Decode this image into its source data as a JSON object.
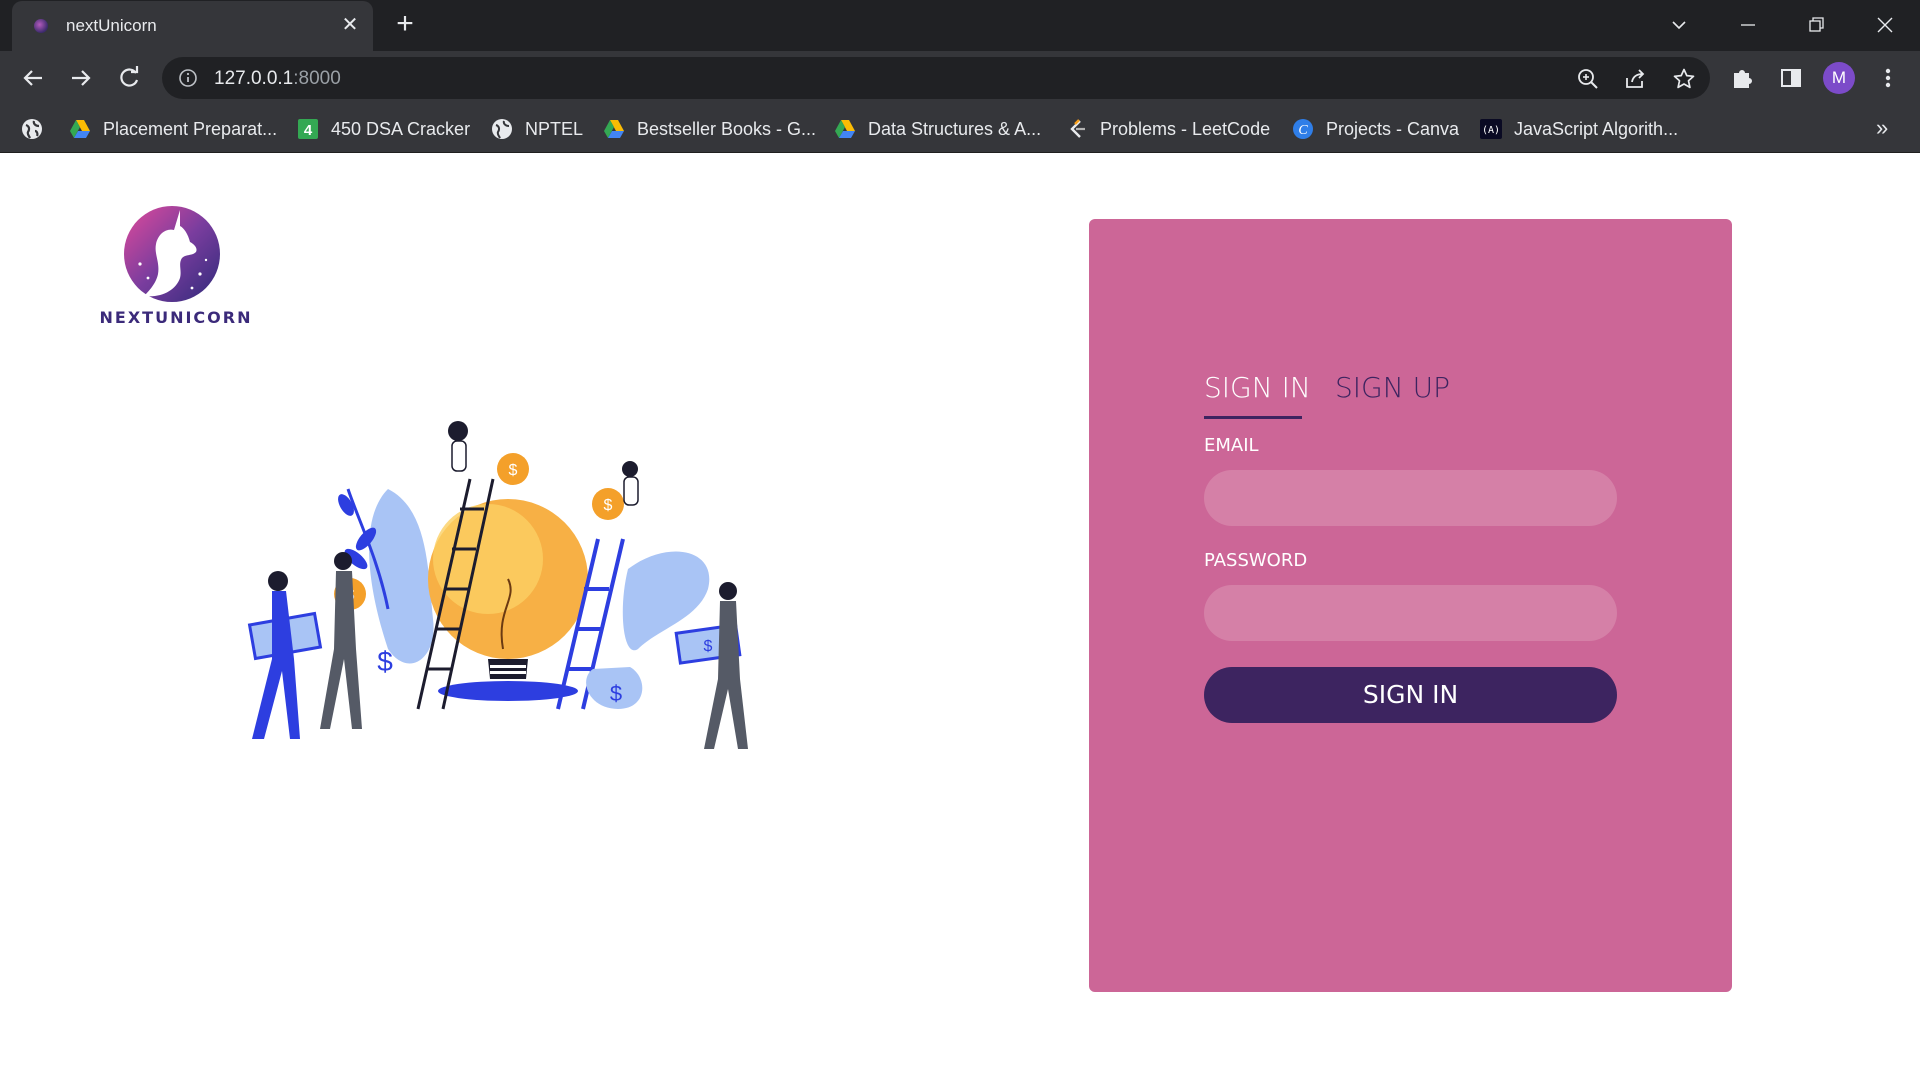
{
  "browser": {
    "tab_title": "nextUnicorn",
    "url_host": "127.0.0.1",
    "url_port": ":8000",
    "profile_initial": "M",
    "bookmarks": [
      {
        "label": "Placement Preparat...",
        "icon": "google-drive-icon"
      },
      {
        "label": "450 DSA Cracker",
        "icon": "sheets-four-icon"
      },
      {
        "label": "NPTEL",
        "icon": "globe-icon"
      },
      {
        "label": "Bestseller Books - G...",
        "icon": "google-drive-icon"
      },
      {
        "label": "Data Structures & A...",
        "icon": "google-drive-icon"
      },
      {
        "label": "Problems - LeetCode",
        "icon": "leetcode-icon"
      },
      {
        "label": "Projects - Canva",
        "icon": "canva-icon"
      },
      {
        "label": "JavaScript Algorith...",
        "icon": "freecodecamp-icon"
      }
    ],
    "more_bookmarks": "»"
  },
  "page": {
    "logo_text": "NEXTUNICORN",
    "auth": {
      "tab_signin": "SIGN IN",
      "tab_signup": "SIGN UP",
      "email_label": "EMAIL",
      "email_value": "",
      "password_label": "PASSWORD",
      "password_value": "",
      "submit_label": "SIGN IN"
    }
  },
  "colors": {
    "card": "#cc6697",
    "field": "#d580a7",
    "accent": "#3d2460"
  }
}
